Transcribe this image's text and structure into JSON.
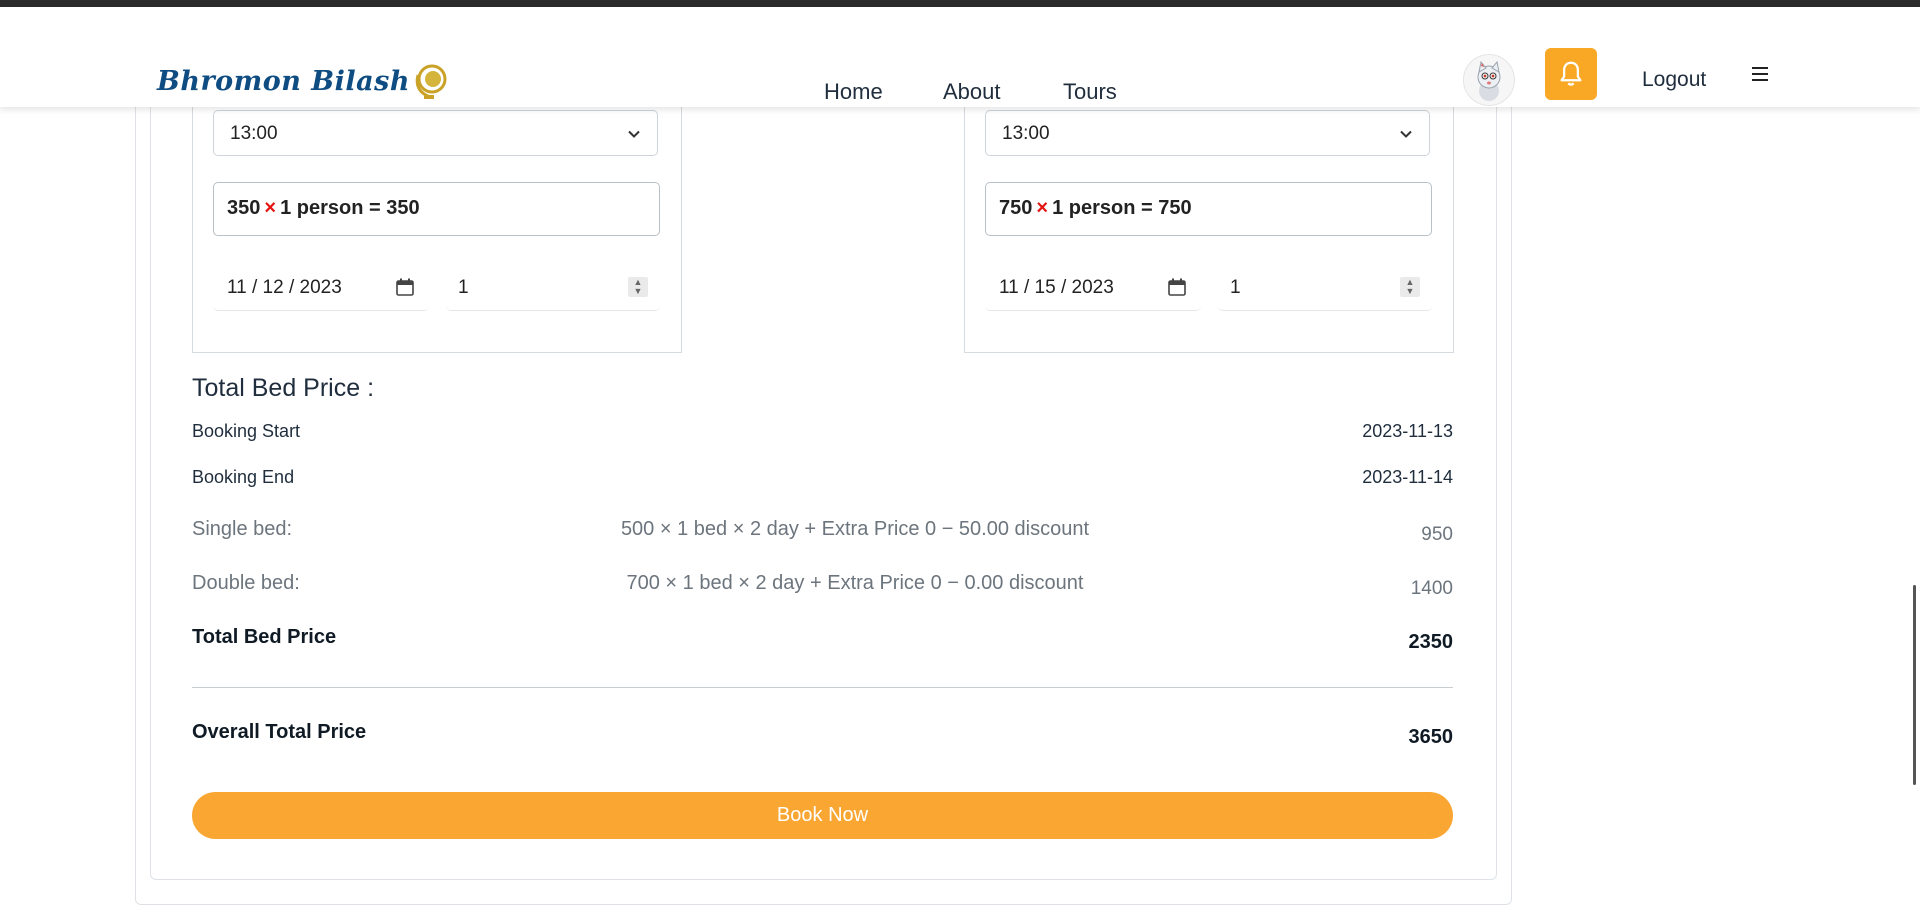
{
  "header": {
    "logo_text": "Bhromon Bilash",
    "nav": [
      "Home",
      "About",
      "Tours"
    ],
    "logout_label": "Logout",
    "accent_color": "#f9a826"
  },
  "rooms": [
    {
      "checkout_time": "13:00",
      "price_line": {
        "unit": "350",
        "mult": "×",
        "persons": "1 person = 350"
      },
      "date": "11 / 12 / 2023",
      "quantity": "1"
    },
    {
      "checkout_time": "13:00",
      "price_line": {
        "unit": "750",
        "mult": "×",
        "persons": "1 person = 750"
      },
      "date": "11 / 15 / 2023",
      "quantity": "1"
    }
  ],
  "summary": {
    "title": "Total Bed Price :",
    "booking_start_label": "Booking Start",
    "booking_start": "2023-11-13",
    "booking_end_label": "Booking End",
    "booking_end": "2023-11-14",
    "single_label": "Single bed:",
    "single_formula": "500 × 1 bed × 2 day + Extra Price 0 − 50.00 discount",
    "single_value": "950",
    "double_label": "Double bed:",
    "double_formula": "700 × 1 bed × 2 day + Extra Price 0 − 0.00 discount",
    "double_value": "1400",
    "total_bed_label": "Total Bed Price",
    "total_bed_value": "2350",
    "overall_label": "Overall Total Price",
    "overall_value": "3650",
    "book_button": "Book Now"
  }
}
